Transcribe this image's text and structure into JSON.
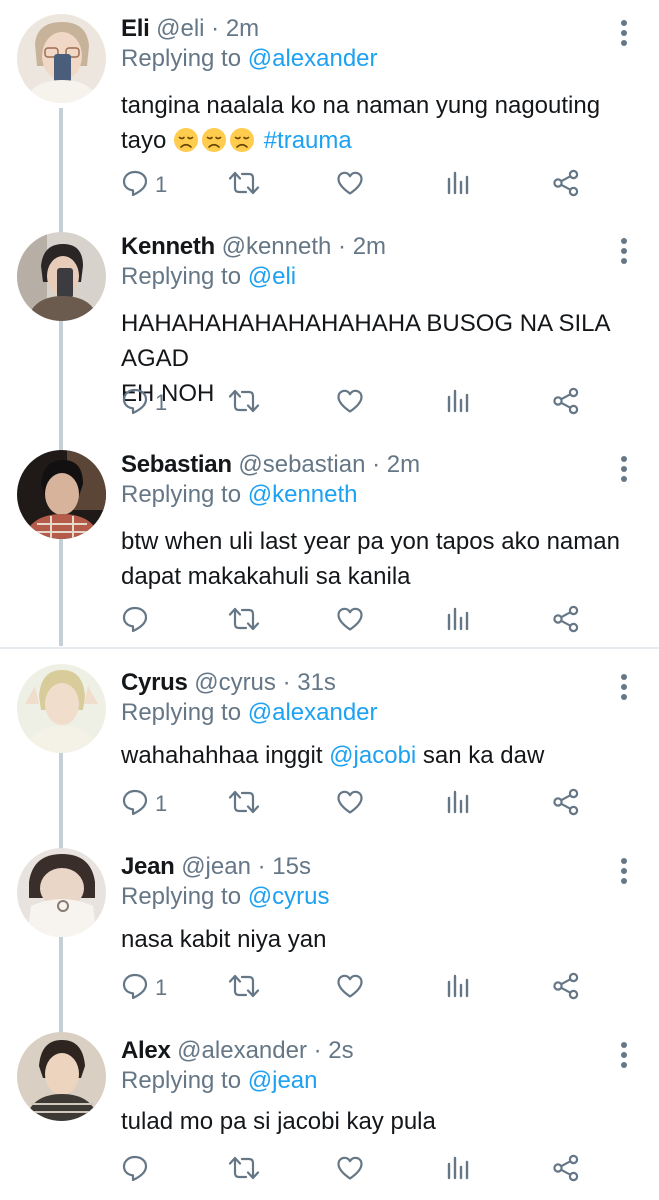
{
  "colors": {
    "link": "#1da1f2",
    "muted": "#657786",
    "divider": "#e6ecf0"
  },
  "icons": {
    "reply": "reply-icon",
    "retweet": "retweet-icon",
    "like": "heart-icon",
    "stats": "stats-icon",
    "share": "share-icon",
    "more": "more-vertical-icon"
  },
  "tweets": [
    {
      "name": "Eli",
      "handle": "@eli",
      "time": "2m",
      "sep": " · ",
      "replying_prefix": "Replying to ",
      "replying_to": "@alexander",
      "text_before": "tangina naalala ko na naman yung nagouting tayo ",
      "hashtag": "#trauma",
      "reply_count": "1"
    },
    {
      "name": "Kenneth",
      "handle": "@kenneth",
      "time": "2m",
      "sep": " · ",
      "replying_prefix": "Replying to ",
      "replying_to": "@eli",
      "text_line1": "HAHAHAHAHAHAHAHAHA BUSOG NA SILA AGAD",
      "text_line2": "EH NOH",
      "reply_count": "1"
    },
    {
      "name": "Sebastian",
      "handle": "@sebastian",
      "time": "2m",
      "sep": " · ",
      "replying_prefix": "Replying to ",
      "replying_to": "@kenneth",
      "text_line1": "btw when uli last year pa yon tapos ako naman",
      "text_line2": "dapat makakahuli sa kanila",
      "reply_count": ""
    },
    {
      "name": "Cyrus",
      "handle": "@cyrus",
      "time": "31s",
      "sep": " · ",
      "replying_prefix": "Replying to ",
      "replying_to": "@alexander",
      "text_before": "wahahahhaa inggit ",
      "mention": "@jacobi",
      "text_after": " san ka daw",
      "reply_count": "1"
    },
    {
      "name": "Jean",
      "handle": "@jean",
      "time": "15s",
      "sep": " · ",
      "replying_prefix": "Replying to ",
      "replying_to": "@cyrus",
      "text": "nasa kabit niya yan",
      "reply_count": "1"
    },
    {
      "name": "Alex",
      "handle": "@alexander",
      "time": "2s",
      "sep": " · ",
      "replying_prefix": "Replying to ",
      "replying_to": "@jean",
      "text": "tulad mo pa si jacobi kay pula",
      "reply_count": ""
    }
  ]
}
